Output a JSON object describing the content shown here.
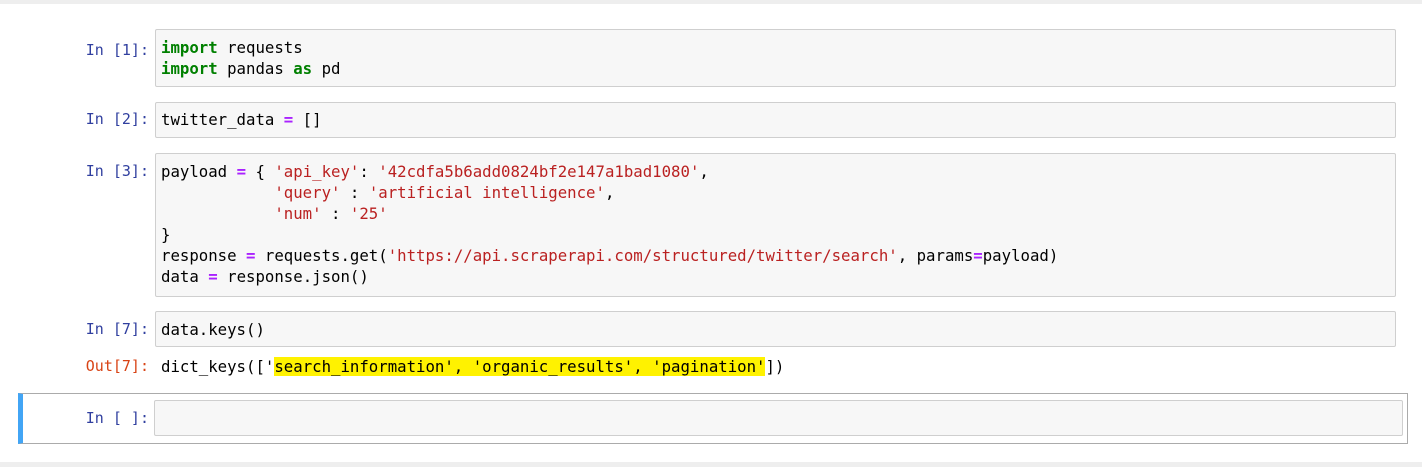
{
  "cells": [
    {
      "prompt": "In [1]:",
      "lines": [
        [
          {
            "t": "import",
            "c": "kw"
          },
          {
            "t": " requests",
            "c": ""
          }
        ],
        [
          {
            "t": "import",
            "c": "kw"
          },
          {
            "t": " pandas ",
            "c": ""
          },
          {
            "t": "as",
            "c": "kw"
          },
          {
            "t": " pd",
            "c": ""
          }
        ]
      ]
    },
    {
      "prompt": "In [2]:",
      "lines": [
        [
          {
            "t": "twitter_data ",
            "c": ""
          },
          {
            "t": "=",
            "c": "op"
          },
          {
            "t": " []",
            "c": ""
          }
        ]
      ]
    },
    {
      "prompt": "In [3]:",
      "lines": [
        [
          {
            "t": "payload ",
            "c": ""
          },
          {
            "t": "=",
            "c": "op"
          },
          {
            "t": " { ",
            "c": ""
          },
          {
            "t": "'api_key'",
            "c": "st"
          },
          {
            "t": ": ",
            "c": ""
          },
          {
            "t": "'42cdfa5b6add0824bf2e147a1bad1080'",
            "c": "st"
          },
          {
            "t": ",",
            "c": ""
          }
        ],
        [
          {
            "t": "            ",
            "c": ""
          },
          {
            "t": "'query'",
            "c": "st"
          },
          {
            "t": " : ",
            "c": ""
          },
          {
            "t": "'artificial intelligence'",
            "c": "st"
          },
          {
            "t": ",",
            "c": ""
          }
        ],
        [
          {
            "t": "            ",
            "c": ""
          },
          {
            "t": "'num'",
            "c": "st"
          },
          {
            "t": " : ",
            "c": ""
          },
          {
            "t": "'25'",
            "c": "st"
          }
        ],
        [
          {
            "t": "}",
            "c": ""
          }
        ],
        [
          {
            "t": "response ",
            "c": ""
          },
          {
            "t": "=",
            "c": "op"
          },
          {
            "t": " requests.get(",
            "c": ""
          },
          {
            "t": "'https://api.scraperapi.com/structured/twitter/search'",
            "c": "st"
          },
          {
            "t": ", params",
            "c": ""
          },
          {
            "t": "=",
            "c": "op"
          },
          {
            "t": "payload)",
            "c": ""
          }
        ],
        [
          {
            "t": "data ",
            "c": ""
          },
          {
            "t": "=",
            "c": "op"
          },
          {
            "t": " response.json()",
            "c": ""
          }
        ]
      ]
    },
    {
      "prompt": "In [7]:",
      "lines": [
        [
          {
            "t": "data.keys()",
            "c": ""
          }
        ]
      ],
      "output": {
        "prompt": "Out[7]:",
        "segments": [
          {
            "t": "dict_keys([",
            "hl": false
          },
          {
            "t": "'",
            "hl": false
          },
          {
            "t": "search_information', 'organic_results', 'pagination'",
            "hl": true
          },
          {
            "t": "])",
            "hl": false
          }
        ]
      }
    },
    {
      "prompt": "In [ ]:",
      "lines": [
        [
          {
            "t": "",
            "c": ""
          }
        ]
      ],
      "selected": true
    }
  ]
}
